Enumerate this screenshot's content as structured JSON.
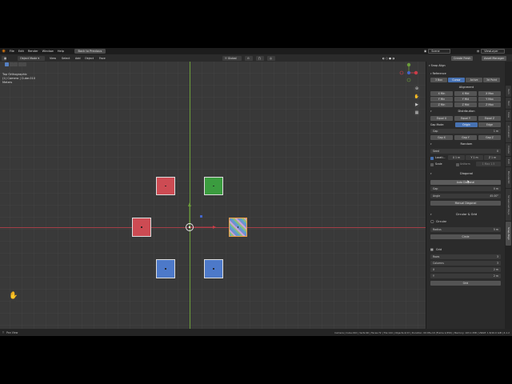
{
  "menubar": {
    "items": [
      "File",
      "Edit",
      "Render",
      "Window",
      "Help"
    ],
    "back_button": "Back to Previous",
    "scene": "Scene",
    "view_layer": "ViewLayer"
  },
  "header": {
    "mode": "Object Mode",
    "menus": [
      "View",
      "Select",
      "Add",
      "Object",
      "Face"
    ],
    "transform": "Global",
    "create_fresh": "Create Fresh",
    "asset_manager": "Asset Manager",
    "options": "Options"
  },
  "viewport": {
    "view_name": "Top Orthographic",
    "collection": "(1) Camera | Cube.010",
    "units": "Meters"
  },
  "statusbar": {
    "left": "Pan View",
    "right": "Camera | Cube.010 | Verts:96 | Faces:72 | Tris:144 | Objects:4/13 | Duration: 00:08+10 (Frame 1/250) | Memory: 163.1 MiB | VRAM: 1.8/10.0 GiB | 4.1.2"
  },
  "panel": {
    "title": "Snap Align",
    "reference": {
      "title": "Reference",
      "options": [
        "3 Box",
        "Cursor",
        "Active",
        "3d Point"
      ],
      "selected": "Cursor"
    },
    "alignment": {
      "title": "Alignment",
      "rows": [
        [
          "X Min",
          "X Mid",
          "X Max"
        ],
        [
          "Y Min",
          "Y Mid",
          "Y Max"
        ],
        [
          "Z Min",
          "Z Mid",
          "Z Max"
        ]
      ]
    },
    "distribution": {
      "title": "Distribution",
      "buttons": [
        "Equal X",
        "Equal Y",
        "Equal Z"
      ],
      "gap_mode_label": "Gap Mode:",
      "gap_modes": [
        "Origin",
        "Edge"
      ],
      "gap_mode_selected": "Origin",
      "gap_label": "Gap",
      "gap_value": "1 m",
      "gap_buttons": [
        "Gap X",
        "Gap Y",
        "Gap Z"
      ]
    },
    "random": {
      "title": "Random",
      "seed_label": "Seed",
      "seed_value": "0",
      "location_label": "Locati...",
      "location_fields": [
        "X 1 m",
        "Y 1 m",
        "Z 1 m"
      ],
      "scale_label": "Scale",
      "uniform_label": "Uniform",
      "scale_field": "1 Max 1.5"
    },
    "diagonal": {
      "title": "Diagonal",
      "auto_button": "Auto Diagonal",
      "gap_label": "Gap",
      "gap_value": "0 m",
      "angle_label": "Angle",
      "angle_value": "45.00°",
      "manual_button": "Manual Diagonal"
    },
    "circular": {
      "title": "Circular & Grid",
      "circular_label": "Circular",
      "radius_label": "Radius",
      "radius_value": "5 m",
      "circle_button": "Circle",
      "grid_label": "Grid",
      "rows_label": "Rows",
      "rows_value": "3",
      "columns_label": "Columns",
      "columns_value": "3",
      "x_label": "X",
      "x_value": "2 m",
      "y_label": "Y",
      "y_value": "2 m",
      "grid_button": "Grid"
    }
  },
  "side_tabs": [
    "Item",
    "Tool",
    "View",
    "Animation",
    "Create",
    "Edit",
    "BlenderKit",
    "Screencast Keys",
    "Snap Align"
  ],
  "colors": {
    "cube_red": "#cd4b53",
    "cube_green": "#3b9c3f",
    "cube_blue": "#4d79c9",
    "accent": "#4772b3"
  }
}
